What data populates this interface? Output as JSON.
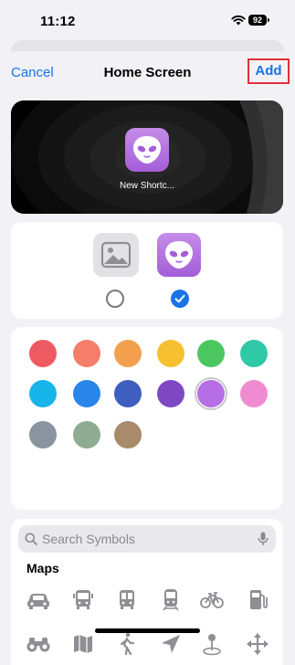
{
  "status_bar": {
    "time": "11:12",
    "battery": "92"
  },
  "nav": {
    "cancel_label": "Cancel",
    "title": "Home Screen",
    "add_label": "Add"
  },
  "preview": {
    "label": "New Shortc..."
  },
  "colors": {
    "accent": "#1a73e8",
    "icon_gradient": [
      "#c58ce8",
      "#a45ed8"
    ],
    "swatches": [
      "#ee5a62",
      "#f57e6a",
      "#f3a04e",
      "#f7c030",
      "#4cc760",
      "#2fc9a8",
      "#17b5ea",
      "#2a85e8",
      "#3e5fbe",
      "#7d48c2",
      "#b56ee6",
      "#f08bd2",
      "#8a94a0",
      "#8fab91",
      "#a98a6a"
    ],
    "selected_swatch_index": 10
  },
  "icon_options": [
    {
      "name": "photo-icon",
      "selected": false
    },
    {
      "name": "alien-icon",
      "selected": true
    }
  ],
  "search": {
    "placeholder": "Search Symbols"
  },
  "symbols": {
    "category": "Maps",
    "icons": [
      "car-icon",
      "bus-icon",
      "bus-front-icon",
      "tram-icon",
      "bicycle-icon",
      "fuel-pump-icon",
      "binoculars-icon",
      "map-icon",
      "walking-person-icon",
      "location-arrow-icon",
      "map-pin-icon",
      "move-arrows-icon"
    ]
  }
}
